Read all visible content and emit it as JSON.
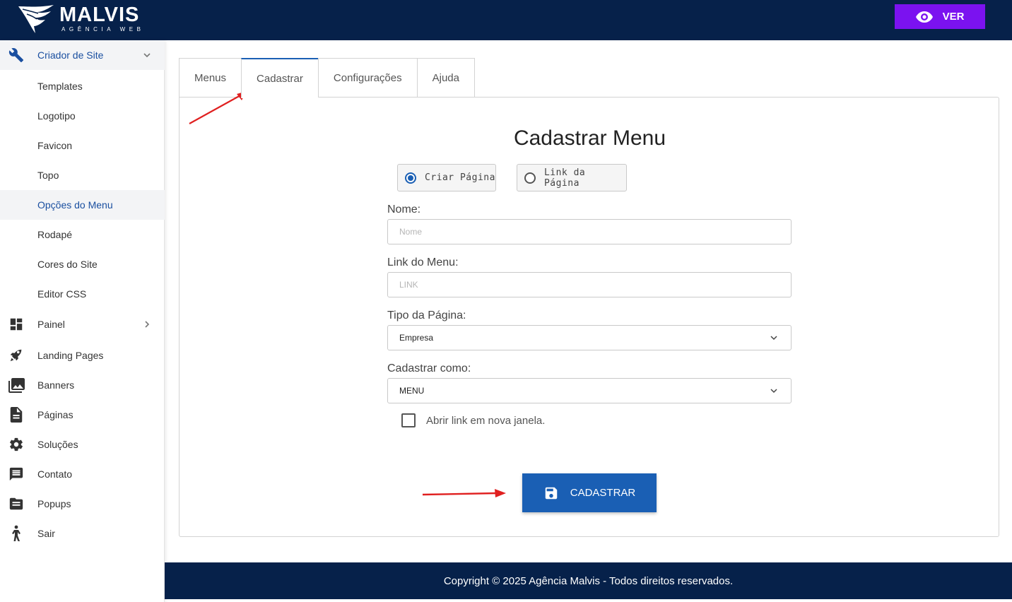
{
  "brand": {
    "name": "MALVIS",
    "tagline": "AGÊNCIA WEB"
  },
  "header": {
    "ver_label": "VER"
  },
  "sidebar": {
    "items": [
      {
        "label": "Criador de Site",
        "icon": "wrench-icon"
      },
      {
        "label": "Templates"
      },
      {
        "label": "Logotipo"
      },
      {
        "label": "Favicon"
      },
      {
        "label": "Topo"
      },
      {
        "label": "Opções do Menu"
      },
      {
        "label": "Rodapé"
      },
      {
        "label": "Cores do Site"
      },
      {
        "label": "Editor CSS"
      },
      {
        "label": "Painel",
        "icon": "dashboard-icon"
      },
      {
        "label": "Landing Pages",
        "icon": "rocket-icon"
      },
      {
        "label": "Banners",
        "icon": "images-icon"
      },
      {
        "label": "Páginas",
        "icon": "file-icon"
      },
      {
        "label": "Soluções",
        "icon": "gear-icon"
      },
      {
        "label": "Contato",
        "icon": "message-icon"
      },
      {
        "label": "Popups",
        "icon": "folder-icon"
      },
      {
        "label": "Sair",
        "icon": "person-exit-icon"
      }
    ]
  },
  "tabs": [
    {
      "label": "Menus"
    },
    {
      "label": "Cadastrar"
    },
    {
      "label": "Configurações"
    },
    {
      "label": "Ajuda"
    }
  ],
  "form": {
    "title": "Cadastrar Menu",
    "radio_create": "Criar Página",
    "radio_link": "Link da Página",
    "name_label": "Nome:",
    "name_placeholder": "Nome",
    "link_label": "Link do Menu:",
    "link_placeholder": "LINK",
    "type_label": "Tipo da Página:",
    "type_value": "Empresa",
    "register_as_label": "Cadastrar como:",
    "register_as_value": "MENU",
    "new_window_label": "Abrir link em nova janela.",
    "submit_label": "CADASTRAR"
  },
  "footer": {
    "copyright": "Copyright © 2025 Agência Malvis - Todos direitos reservados."
  },
  "colors": {
    "navy": "#06214a",
    "purple": "#7b12f0",
    "blue": "#1a5fb4",
    "arrow": "#e02020"
  }
}
